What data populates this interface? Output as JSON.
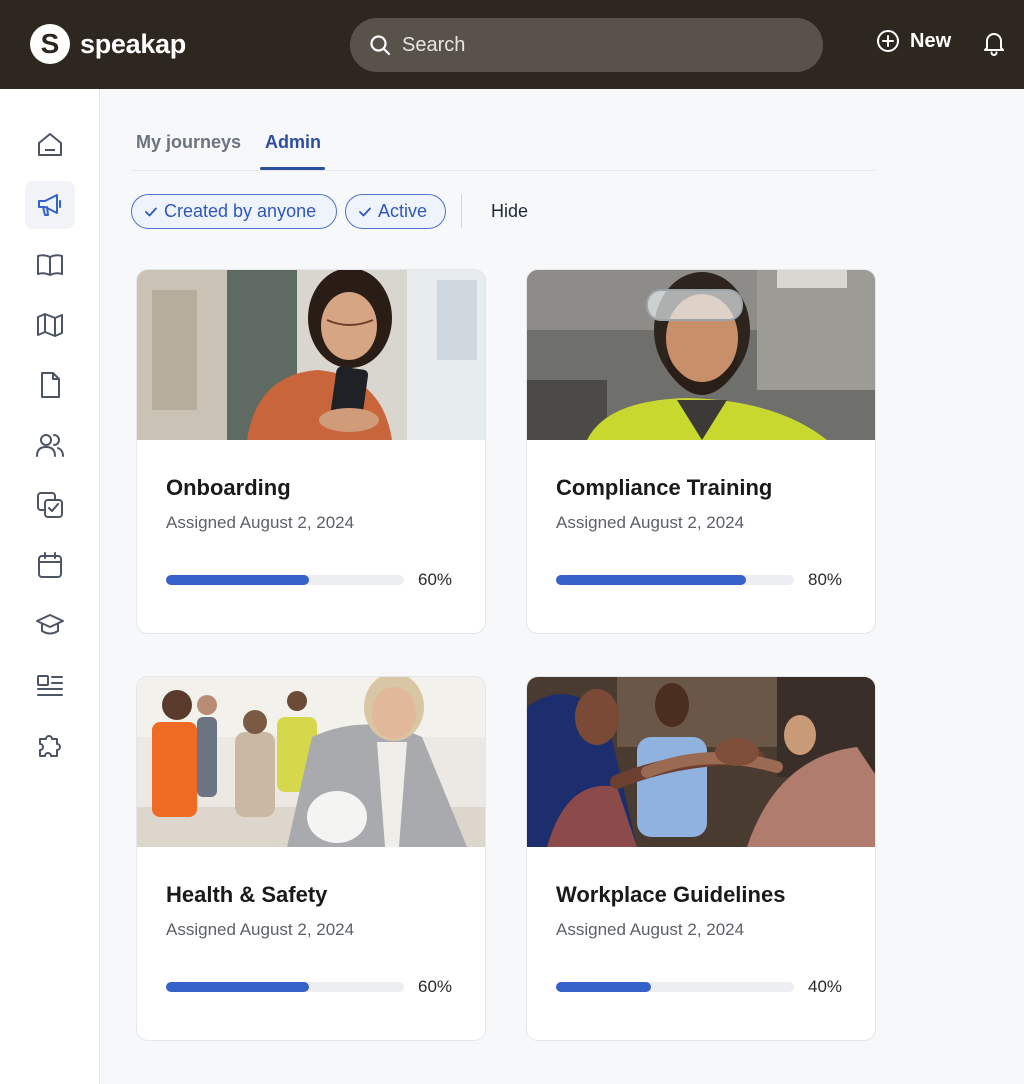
{
  "header": {
    "logo_letter": "S",
    "logo_text": "speakap",
    "search_placeholder": "Search",
    "new_label": "New"
  },
  "sidebar": {
    "items": [
      {
        "icon": "home-icon",
        "active": false
      },
      {
        "icon": "megaphone-icon",
        "active": true
      },
      {
        "icon": "book-icon",
        "active": false
      },
      {
        "icon": "map-icon",
        "active": false
      },
      {
        "icon": "document-icon",
        "active": false
      },
      {
        "icon": "users-icon",
        "active": false
      },
      {
        "icon": "tasks-icon",
        "active": false
      },
      {
        "icon": "calendar-icon",
        "active": false
      },
      {
        "icon": "graduation-cap-icon",
        "active": false
      },
      {
        "icon": "news-icon",
        "active": false
      },
      {
        "icon": "puzzle-icon",
        "active": false
      }
    ]
  },
  "tabs": [
    {
      "label": "My journeys",
      "active": false
    },
    {
      "label": "Admin",
      "active": true
    }
  ],
  "filters": {
    "chips": [
      {
        "label": "Created by anyone"
      },
      {
        "label": "Active"
      }
    ],
    "hide_label": "Hide"
  },
  "cards": [
    {
      "title": "Onboarding",
      "subtitle": "Assigned August 2, 2024",
      "progress": 60,
      "progress_label": "60%"
    },
    {
      "title": "Compliance Training",
      "subtitle": "Assigned August 2, 2024",
      "progress": 80,
      "progress_label": "80%"
    },
    {
      "title": "Health & Safety",
      "subtitle": "Assigned August 2, 2024",
      "progress": 60,
      "progress_label": "60%"
    },
    {
      "title": "Workplace Guidelines",
      "subtitle": "Assigned August 2, 2024",
      "progress": 40,
      "progress_label": "40%"
    }
  ],
  "colors": {
    "topbar": "#2d2720",
    "accent": "#3561c9",
    "tab_active": "#2b4e9e"
  }
}
